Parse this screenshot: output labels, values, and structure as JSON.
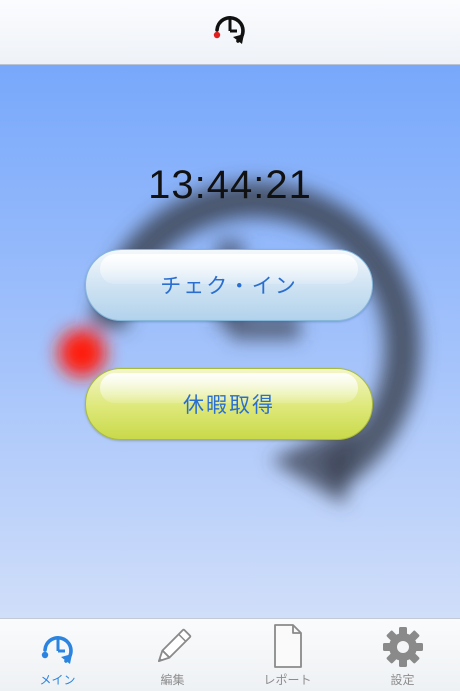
{
  "header": {
    "logo_icon": "clock-logo-icon"
  },
  "main": {
    "time": "13:44:21",
    "checkin_label": "チェク・イン",
    "leave_label": "休暇取得"
  },
  "tabs": [
    {
      "label": "メイン",
      "icon": "clock-icon",
      "active": true
    },
    {
      "label": "編集",
      "icon": "pencil-icon",
      "active": false
    },
    {
      "label": "レポート",
      "icon": "document-icon",
      "active": false
    },
    {
      "label": "設定",
      "icon": "gear-icon",
      "active": false
    }
  ],
  "colors": {
    "active_tab": "#2a84e0",
    "inactive_tab": "#8c8c8c",
    "logo_dot": "#e0201f"
  }
}
